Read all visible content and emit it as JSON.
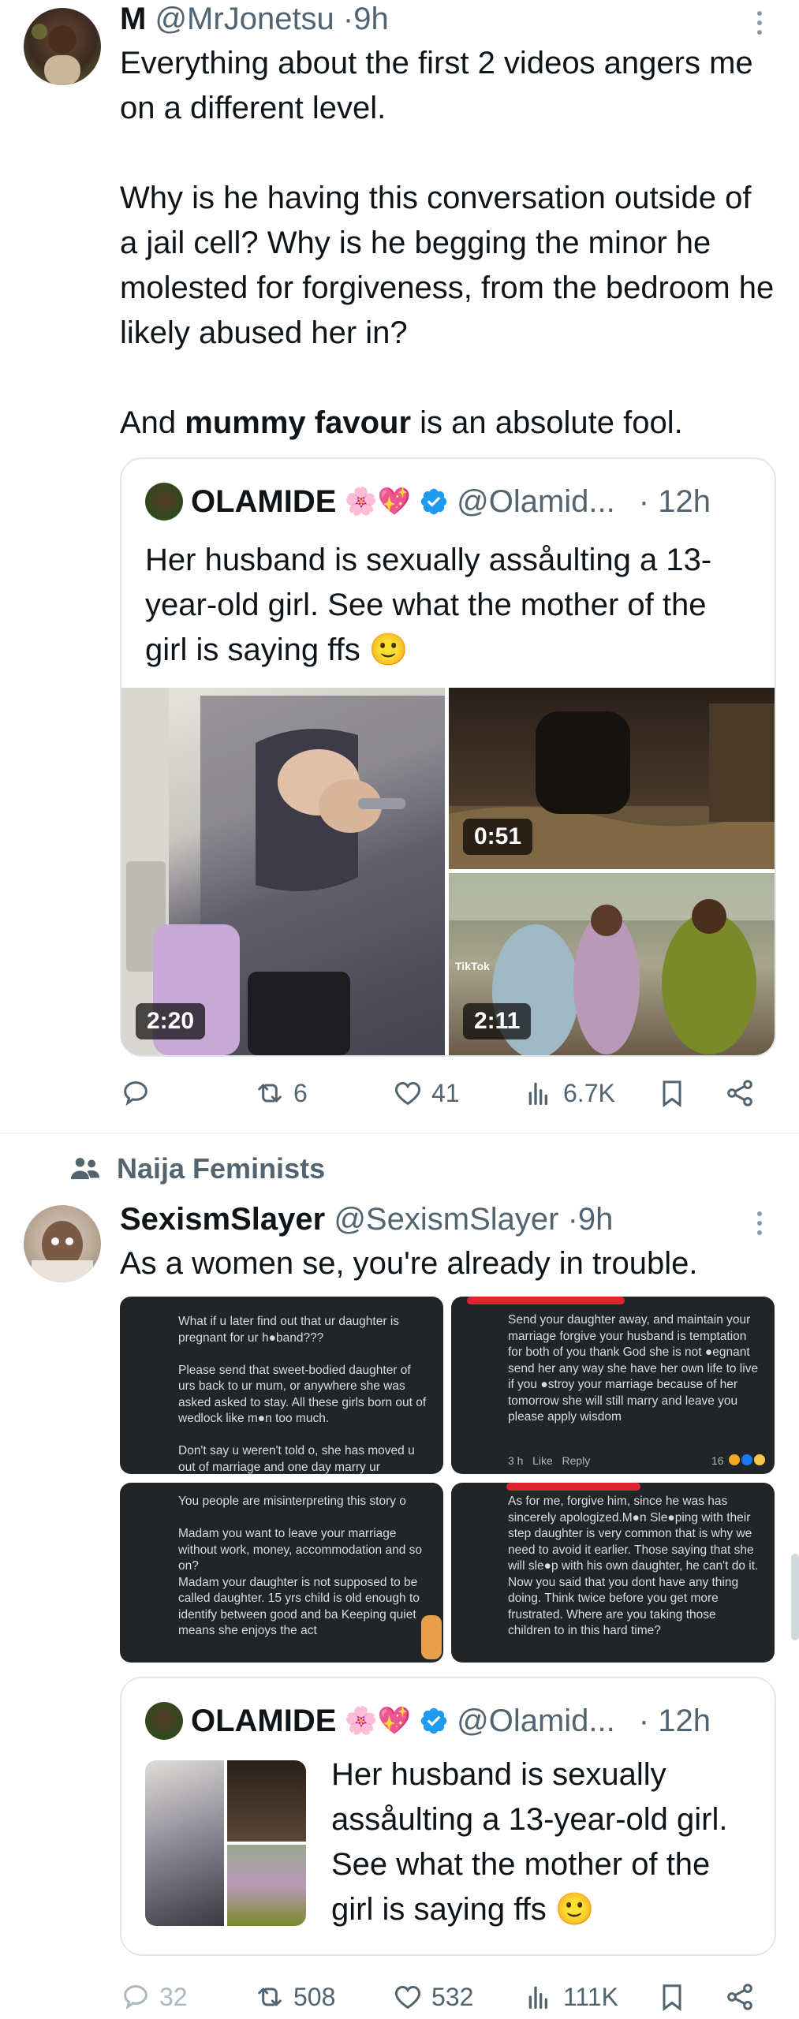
{
  "tweet1": {
    "display_name": "M",
    "handle": "@MrJonetsu",
    "time": "9h",
    "separator": "·",
    "text_p1": "Everything about the first 2 videos angers me on a different level.",
    "text_p2": "Why is he having this conversation outside of a jail cell? Why is he begging the minor he molested for forgiveness, from the bedroom he likely abused her in?",
    "text_p3_pre": "And ",
    "text_p3_bold": "mummy favour",
    "text_p3_post": " is an absolute fool.",
    "quote": {
      "display_name": "OLAMIDE",
      "emoji": "🌸💖",
      "handle": "@Olamid...",
      "time": "· 12h",
      "text": "Her husband is sexually assåulting a 13-year-old girl. See what the mother of the girl is saying ffs 🙂",
      "videos": [
        {
          "duration": "2:20"
        },
        {
          "duration": "0:51"
        },
        {
          "duration": "2:11",
          "watermark": "TikTok"
        }
      ]
    },
    "actions": {
      "reply_count": "",
      "retweet_count": "6",
      "like_count": "41",
      "views_count": "6.7K"
    }
  },
  "community": {
    "label": "Naija Feminists"
  },
  "tweet2": {
    "display_name": "SexismSlayer",
    "handle": "@SexismSlayer",
    "time": "9h",
    "separator": "·",
    "text": "As a women se, you're already in trouble.",
    "screenshots": [
      {
        "text": "What if u later find out that ur daughter is pregnant for ur h●band???\n\nPlease send that sweet-bodied daughter of urs back to ur mum, or anywhere she was asked asked to stay. All these girls born out of wedlock like m●n too much.\n\nDon't say u weren't told o, she has moved u out of marriage and one day marry ur"
      },
      {
        "text": "Send your daughter away, and maintain your marriage forgive your husband is temptation for both of you thank God she is not ●egnant send her any way she have her own life to live if you ●stroy your marriage because of her tomorrow she will still marry and leave you please apply wisdom",
        "meta": "3 h   Like   Reply",
        "reactions": "16"
      },
      {
        "text": "You people are misinterpreting this story o\n\nMadam you want to leave your marriage without work, money, accommodation and so on?\nMadam your daughter is not supposed to be called daughter. 15 yrs child is old enough to identify between good and ba Keeping quiet means she enjoys the act"
      },
      {
        "text": "As for me, forgive him, since he was has sincerely apologized.M●n Sle●ping with their step daughter is very common that is why we need to avoid it earlier. Those saying that she will sle●p with his own daughter, he can't do it. Now you said that you dont have any thing doing. Think twice before you get more frustrated. Where are you taking those children to in this hard time?"
      }
    ],
    "quote": {
      "display_name": "OLAMIDE",
      "emoji": "🌸💖",
      "handle": "@Olamid...",
      "time": "· 12h",
      "text": "Her husband is sexually assåulting a 13-year-old girl. See what the mother of the girl is saying ffs 🙂"
    },
    "actions": {
      "reply_count": "32",
      "retweet_count": "508",
      "like_count": "532",
      "views_count": "111K"
    }
  },
  "colors": {
    "text": "#0f1419",
    "muted": "#536471",
    "verified": "#1d9bf0",
    "border": "#e1e8ed"
  }
}
